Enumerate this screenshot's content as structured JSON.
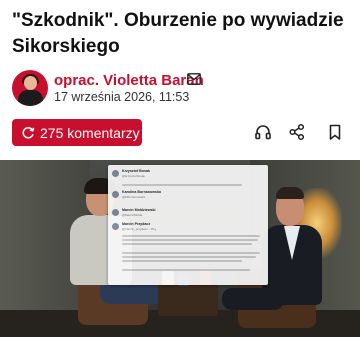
{
  "article": {
    "title": "\"Szkodnik\". Oburzenie po wywiadzie Sikorskiego",
    "author_label": "oprac. Violetta Baran",
    "date": "17 września 2026, 11:53"
  },
  "actions": {
    "comments_label": "275 komentarzy",
    "icons": [
      "headphones-icon",
      "share-icon",
      "bookmark-icon"
    ]
  },
  "photo": {
    "tweets": [
      {
        "name": "Krzysztof Bosak",
        "handle": "@krzysztofbosak",
        "text": "Od szefa polskiej dyplomacji należy..."
      },
      {
        "name": "Karolina Bornanowska",
        "handle": "@KBornanowska",
        "text": ""
      },
      {
        "name": "Marcin Mołdziewski",
        "handle": "@MarcinMolda",
        "text": "... tuż 16 członków mojej"
      },
      {
        "name": "Marcin Przydacz",
        "handle": "@marcin_przydacz · 18 g",
        "text": "Roman Ziemowit był jednym z wielu..."
      }
    ]
  },
  "colors": {
    "brand_red": "#c8102e"
  }
}
